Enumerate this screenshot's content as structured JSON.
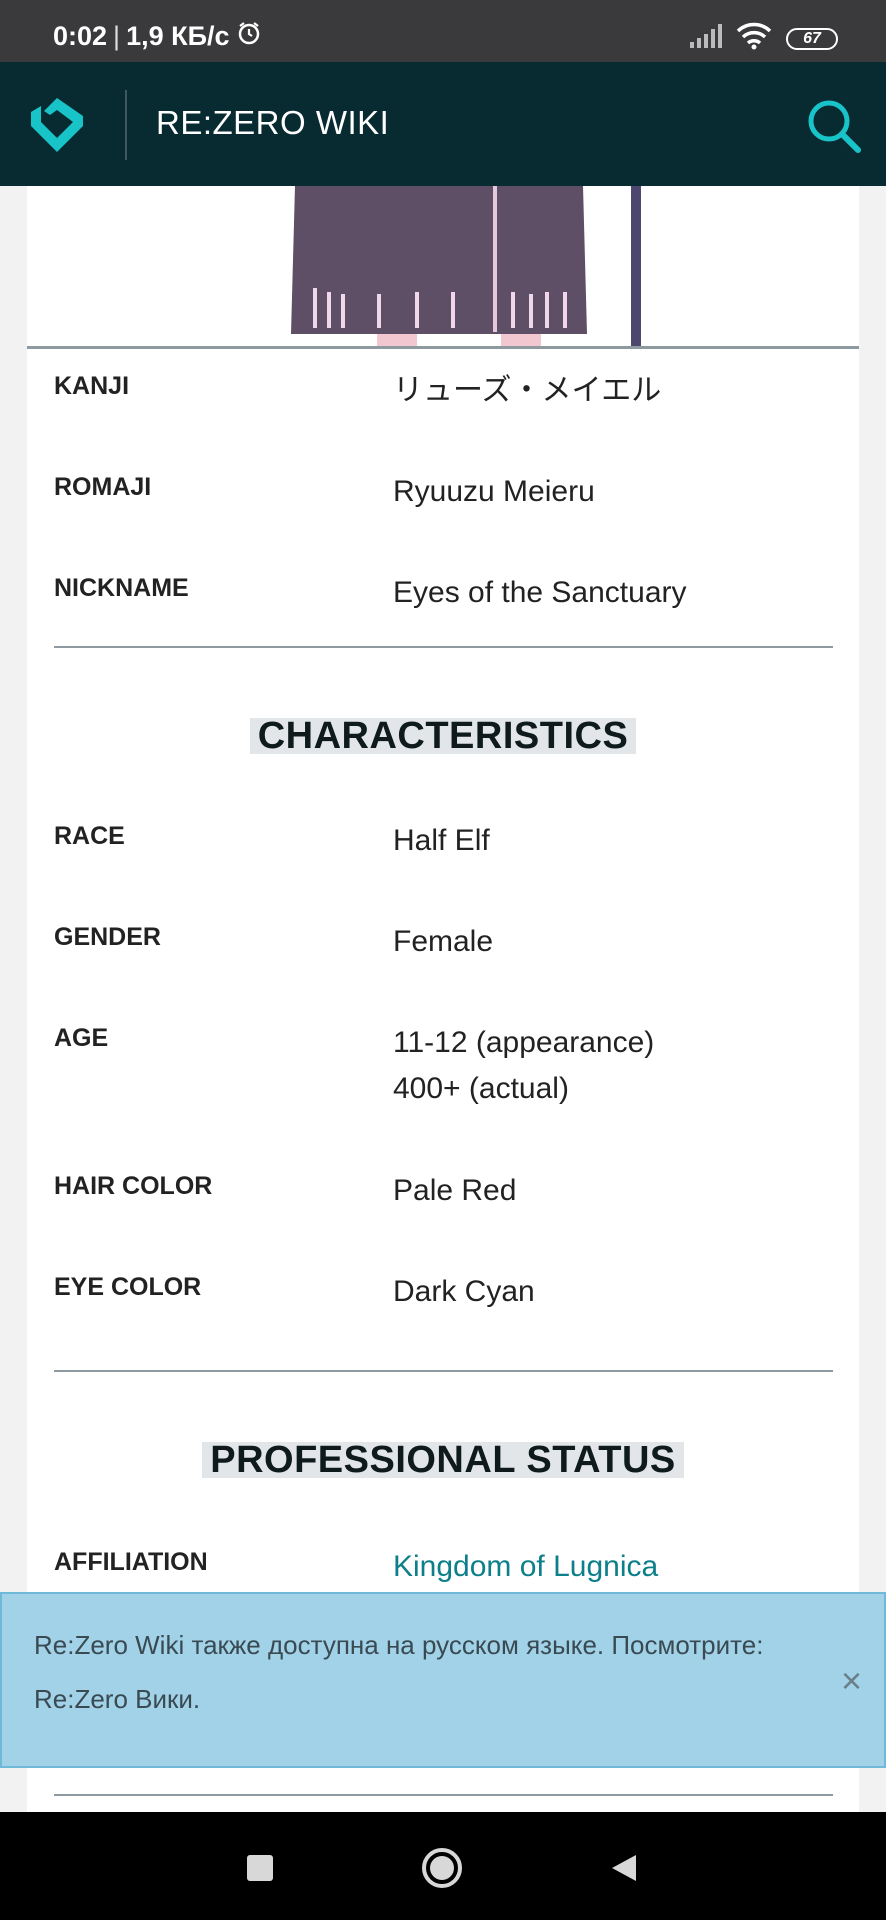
{
  "status_bar": {
    "time": "0:02",
    "speed": "1,9 КБ/с",
    "battery": "67"
  },
  "header": {
    "title": "RE:ZERO WIKI"
  },
  "names": [
    {
      "label": "KANJI",
      "value": "リューズ・メイエル"
    },
    {
      "label": "ROMAJI",
      "value": "Ryuuzu Meieru"
    },
    {
      "label": "NICKNAME",
      "value": "Eyes of the Sanctuary"
    }
  ],
  "characteristics": {
    "heading": "CHARACTERISTICS",
    "rows": [
      {
        "label": "RACE",
        "value": "Half Elf"
      },
      {
        "label": "GENDER",
        "value": "Female"
      },
      {
        "label": "AGE",
        "value": "11-12 (appearance)",
        "value2": "400+ (actual)"
      },
      {
        "label": "HAIR COLOR",
        "value": "Pale Red"
      },
      {
        "label": "EYE COLOR",
        "value": "Dark Cyan"
      }
    ]
  },
  "professional": {
    "heading": "PROFESSIONAL STATUS",
    "rows": [
      {
        "label": "AFFILIATION",
        "value": "Kingdom of Lugnica"
      }
    ]
  },
  "banner": {
    "message": "Re:Zero Wiki также доступна на русском языке. Посмотрите: Re:Zero Вики.",
    "close": "×"
  },
  "colors": {
    "header_bg": "#072b31",
    "accent": "#0c7f8a",
    "banner_bg": "#a1d2e8"
  }
}
